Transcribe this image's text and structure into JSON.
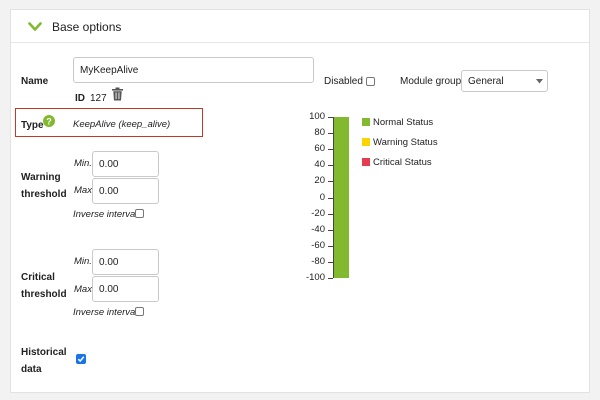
{
  "section": {
    "title": "Base options"
  },
  "name": {
    "label": "Name",
    "value": "MyKeepAlive"
  },
  "id": {
    "label": "ID",
    "value": "127"
  },
  "disabled": {
    "label": "Disabled",
    "checked": false
  },
  "module_group": {
    "label": "Module group",
    "value": "General"
  },
  "type": {
    "label": "Type",
    "value": "KeepAlive (keep_alive)"
  },
  "warning": {
    "label_line1": "Warning",
    "label_line2": "threshold",
    "min_label": "Min.",
    "min_value": "0.00",
    "max_label": "Max.",
    "max_value": "0.00",
    "inverse_label": "Inverse interval",
    "inverse_checked": false
  },
  "critical": {
    "label_line1": "Critical",
    "label_line2": "threshold",
    "min_label": "Min.",
    "min_value": "0.00",
    "max_label": "Max.",
    "max_value": "0.00",
    "inverse_label": "Inverse interval",
    "inverse_checked": false
  },
  "historical": {
    "label_line1": "Historical",
    "label_line2": "data",
    "checked": true
  },
  "status_chart": {
    "ticks": [
      "100",
      "80",
      "60",
      "40",
      "20",
      "0",
      "-20",
      "-40",
      "-60",
      "-80",
      "-100"
    ],
    "range": [
      -100,
      100
    ],
    "normal_range": [
      -100,
      100
    ]
  },
  "legend": [
    {
      "label": "Normal Status",
      "color": "#82b92e"
    },
    {
      "label": "Warning Status",
      "color": "#fad403"
    },
    {
      "label": "Critical Status",
      "color": "#e63c52"
    }
  ],
  "colors": {
    "accent_green": "#82b92e",
    "highlight_border": "#c0392b",
    "checkbox_blue": "#1a73e8"
  }
}
